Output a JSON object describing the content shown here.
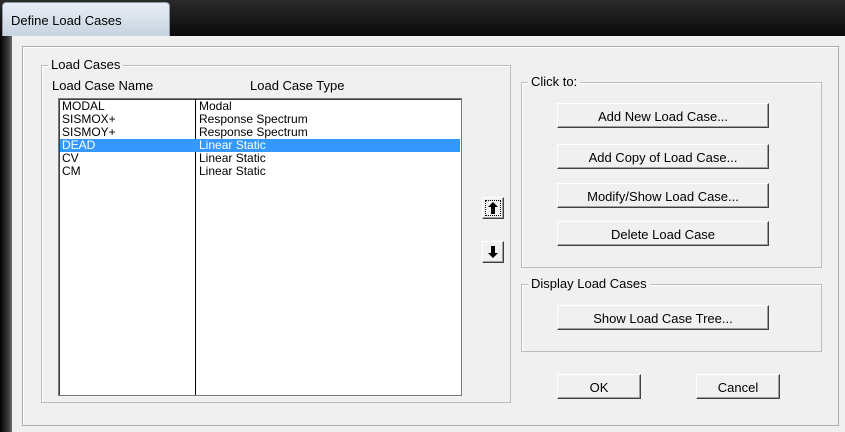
{
  "window": {
    "title": "Define Load Cases"
  },
  "load_cases_group": {
    "legend": "Load Cases",
    "col_name_header": "Load Case Name",
    "col_type_header": "Load Case Type",
    "rows": [
      {
        "name": "MODAL",
        "type": "Modal",
        "selected": false
      },
      {
        "name": "SISMOX+",
        "type": "Response Spectrum",
        "selected": false
      },
      {
        "name": "SISMOY+",
        "type": "Response Spectrum",
        "selected": false
      },
      {
        "name": "DEAD",
        "type": "Linear Static",
        "selected": true
      },
      {
        "name": "CV",
        "type": "Linear Static",
        "selected": false
      },
      {
        "name": "CM",
        "type": "Linear Static",
        "selected": false
      }
    ]
  },
  "move_buttons": {
    "up_icon": "arrow-up-icon",
    "down_icon": "arrow-down-icon"
  },
  "click_to_group": {
    "legend": "Click to:",
    "add_new": "Add New Load Case...",
    "add_copy": "Add Copy of Load Case...",
    "modify_show": "Modify/Show Load Case...",
    "delete": "Delete Load Case"
  },
  "display_group": {
    "legend": "Display Load Cases",
    "show_tree": "Show Load Case Tree..."
  },
  "footer": {
    "ok": "OK",
    "cancel": "Cancel"
  },
  "colors": {
    "selection": "#3399ff",
    "dialog_bg": "#f0f0f0"
  }
}
